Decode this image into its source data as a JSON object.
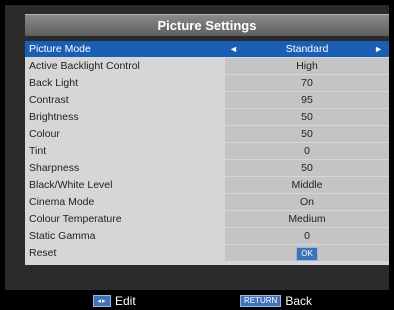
{
  "title": "Picture Settings",
  "menu": {
    "rows": [
      {
        "label": "Picture Mode",
        "value": "Standard"
      },
      {
        "label": "Active Backlight Control",
        "value": "High"
      },
      {
        "label": "Back Light",
        "value": "70"
      },
      {
        "label": "Contrast",
        "value": "95"
      },
      {
        "label": "Brightness",
        "value": "50"
      },
      {
        "label": "Colour",
        "value": "50"
      },
      {
        "label": "Tint",
        "value": "0"
      },
      {
        "label": "Sharpness",
        "value": "50"
      },
      {
        "label": "Black/White Level",
        "value": "Middle"
      },
      {
        "label": "Cinema Mode",
        "value": "On"
      },
      {
        "label": "Colour Temperature",
        "value": "Medium"
      },
      {
        "label": "Static Gamma",
        "value": "0"
      },
      {
        "label": "Reset",
        "value": "OK"
      }
    ],
    "selected_index": 0
  },
  "footer": {
    "edit_label": "Edit",
    "return_key": "RETURN",
    "back_label": "Back"
  },
  "colors": {
    "selection": "#1b5fb4",
    "key_badge": "#3f72b9"
  },
  "icons": {
    "left_arrow": "left-arrow-icon",
    "right_arrow": "right-arrow-icon",
    "nav": "left-right-nav-icon"
  }
}
